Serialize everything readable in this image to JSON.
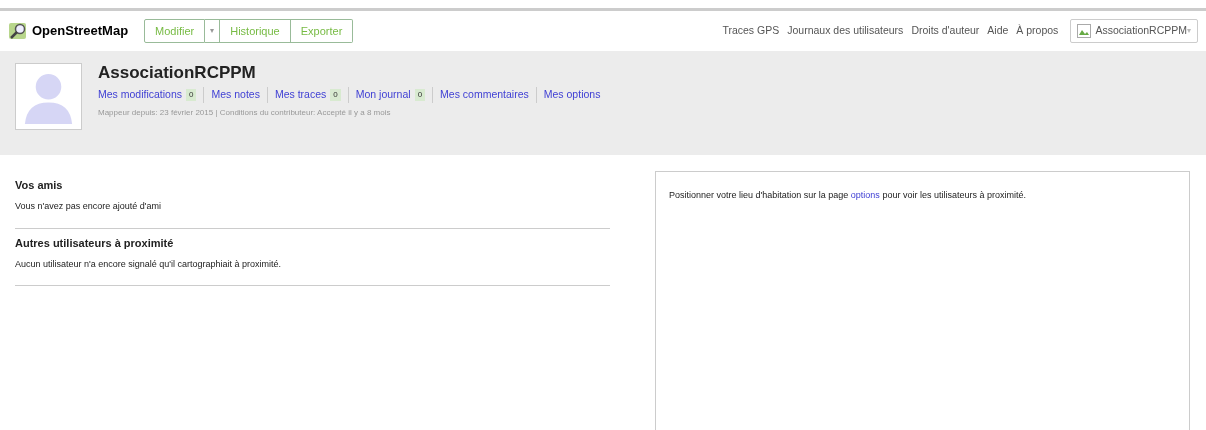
{
  "header": {
    "brand": "OpenStreetMap",
    "edit_buttons": [
      {
        "label": "Modifier",
        "kind": "button"
      },
      {
        "label": "▾",
        "kind": "caret"
      },
      {
        "label": "Historique",
        "kind": "button"
      },
      {
        "label": "Exporter",
        "kind": "button"
      }
    ],
    "nav_links": [
      "Traces GPS",
      "Journaux des utilisateurs",
      "Droits d'auteur",
      "Aide",
      "À propos"
    ],
    "user_menu": {
      "label": "AssociationRCPPM",
      "caret": "▾"
    }
  },
  "profile": {
    "username": "AssociationRCPPM",
    "links": [
      {
        "label": "Mes modifications",
        "count": "0"
      },
      {
        "label": "Mes notes"
      },
      {
        "label": "Mes traces",
        "count": "0"
      },
      {
        "label": "Mon journal",
        "count": "0"
      },
      {
        "label": "Mes commentaires"
      },
      {
        "label": "Mes options"
      }
    ],
    "meta": "Mappeur depuis: 23 février 2015 | Conditions du contributeur: Accepté il y a 8 mois"
  },
  "sections": [
    {
      "title": "Vos amis",
      "text": "Vous n'avez pas encore ajouté d'ami"
    },
    {
      "title": "Autres utilisateurs à proximité",
      "text": "Aucun utilisateur n'a encore signalé qu'il cartographiait à proximité."
    }
  ],
  "map_panel": {
    "text_before": "Positionner votre lieu d'habitation sur la page",
    "link": "options",
    "text_after": "pour voir les utilisateurs à proximité."
  }
}
